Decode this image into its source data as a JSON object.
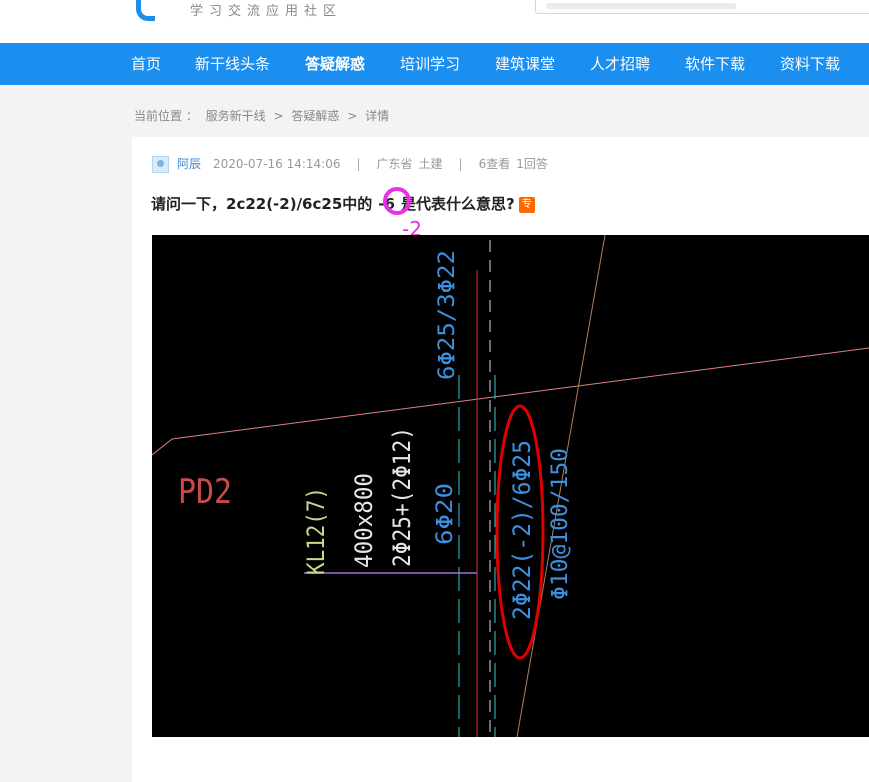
{
  "header": {
    "slogan": "学习交流应用社区"
  },
  "nav": {
    "items": [
      {
        "label": "首页",
        "active": false
      },
      {
        "label": "新干线头条",
        "active": false
      },
      {
        "label": "答疑解惑",
        "active": true
      },
      {
        "label": "培训学习",
        "active": false
      },
      {
        "label": "建筑课堂",
        "active": false
      },
      {
        "label": "人才招聘",
        "active": false
      },
      {
        "label": "软件下载",
        "active": false
      },
      {
        "label": "资料下载",
        "active": false
      }
    ],
    "color": "#1a8ff0"
  },
  "breadcrumb": {
    "prefix": "当前位置 ：",
    "items": [
      "服务新干线",
      "答疑解惑",
      "详情"
    ],
    "separator": ">"
  },
  "question": {
    "author": "阿辰",
    "datetime": "2020-07-16 14:14:06",
    "location": "广东省",
    "category": "土建",
    "views": "6查看",
    "answers": "1回答",
    "title_before": "请问一下，2c22(-2)/6c25中的",
    "title_highlight": "-6",
    "title_after": "是代表什么意思?",
    "badge": "专",
    "annotation": "-2"
  },
  "drawing": {
    "labels": {
      "pd": "PD2",
      "beam": "KL12(7)",
      "size": "400x800",
      "top_bars": "2Φ25+(2Φ12)",
      "left_bars": "6Φ20",
      "upper_bars": "6Φ25/3Φ22",
      "circled_bars": "2Φ22(-2)/6Φ25",
      "stirrups": "Φ10@100/150"
    },
    "colors": {
      "blue": "#3d8fe0",
      "red_line": "#e03030",
      "pd": "#c84a4a",
      "beam": "#c8d88a",
      "white": "#e6e6e6",
      "cyan": "#30c8d8",
      "pink": "#e08080",
      "purple": "#a070d8",
      "tan": "#b08060",
      "ellipse": "#e00000"
    }
  }
}
